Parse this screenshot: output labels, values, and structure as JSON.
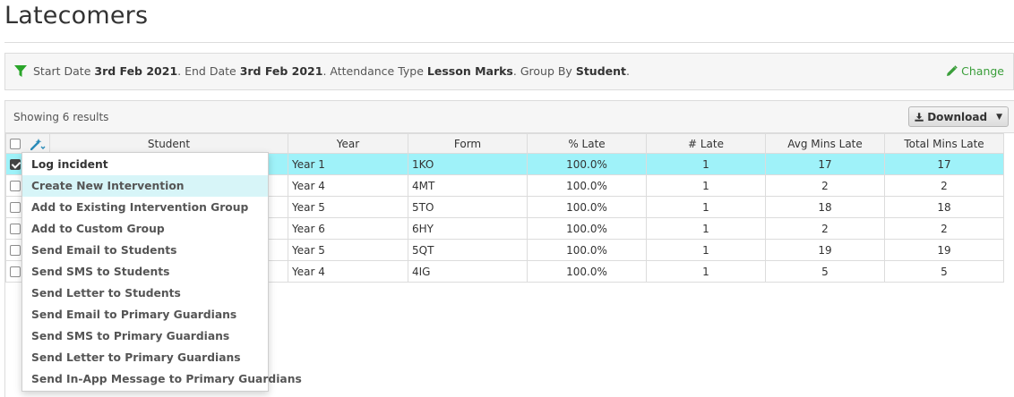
{
  "page": {
    "title": "Latecomers"
  },
  "filter": {
    "start_label": "Start Date",
    "start_value": "3rd Feb 2021",
    "end_label": ". End Date",
    "end_value": "3rd Feb 2021",
    "type_label": ". Attendance Type",
    "type_value": "Lesson Marks",
    "group_label": ". Group By",
    "group_value": "Student",
    "trailing": ".",
    "change_label": "Change"
  },
  "results": {
    "showing_label": "Showing 6 results",
    "download_label": "Download"
  },
  "table": {
    "columns": [
      "Student",
      "Year",
      "Form",
      "% Late",
      "# Late",
      "Avg Mins Late",
      "Total Mins Late"
    ],
    "rows": [
      {
        "checked": true,
        "year": "Year 1",
        "form": "1KO",
        "pct_late": "100.0%",
        "num_late": "1",
        "avg_mins": "17",
        "total_mins": "17"
      },
      {
        "checked": false,
        "year": "Year 4",
        "form": "4MT",
        "pct_late": "100.0%",
        "num_late": "1",
        "avg_mins": "2",
        "total_mins": "2"
      },
      {
        "checked": false,
        "year": "Year 5",
        "form": "5TO",
        "pct_late": "100.0%",
        "num_late": "1",
        "avg_mins": "18",
        "total_mins": "18"
      },
      {
        "checked": false,
        "year": "Year 6",
        "form": "6HY",
        "pct_late": "100.0%",
        "num_late": "1",
        "avg_mins": "2",
        "total_mins": "2"
      },
      {
        "checked": false,
        "year": "Year 5",
        "form": "5QT",
        "pct_late": "100.0%",
        "num_late": "1",
        "avg_mins": "19",
        "total_mins": "19"
      },
      {
        "checked": false,
        "year": "Year 4",
        "form": "4IG",
        "pct_late": "100.0%",
        "num_late": "1",
        "avg_mins": "5",
        "total_mins": "5"
      }
    ]
  },
  "actions_menu": {
    "items": [
      "Log incident",
      "Create New Intervention",
      "Add to Existing Intervention Group",
      "Add to Custom Group",
      "Send Email to Students",
      "Send SMS to Students",
      "Send Letter to Students",
      "Send Email to Primary Guardians",
      "Send SMS to Primary Guardians",
      "Send Letter to Primary Guardians",
      "Send In-App Message to Primary Guardians"
    ],
    "highlighted_index": 1
  },
  "colors": {
    "selected_row": "#9ff2f9",
    "menu_hover": "#d7f5f8",
    "accent_green": "#3a9e3a",
    "filter_icon": "#2aa52a",
    "tool_icon": "#2a8bb8"
  },
  "icons": {
    "filter": "filter-icon",
    "change": "pencil-icon",
    "download": "download-icon",
    "tools": "magic-wand-icon",
    "caret": "caret-down-icon"
  }
}
